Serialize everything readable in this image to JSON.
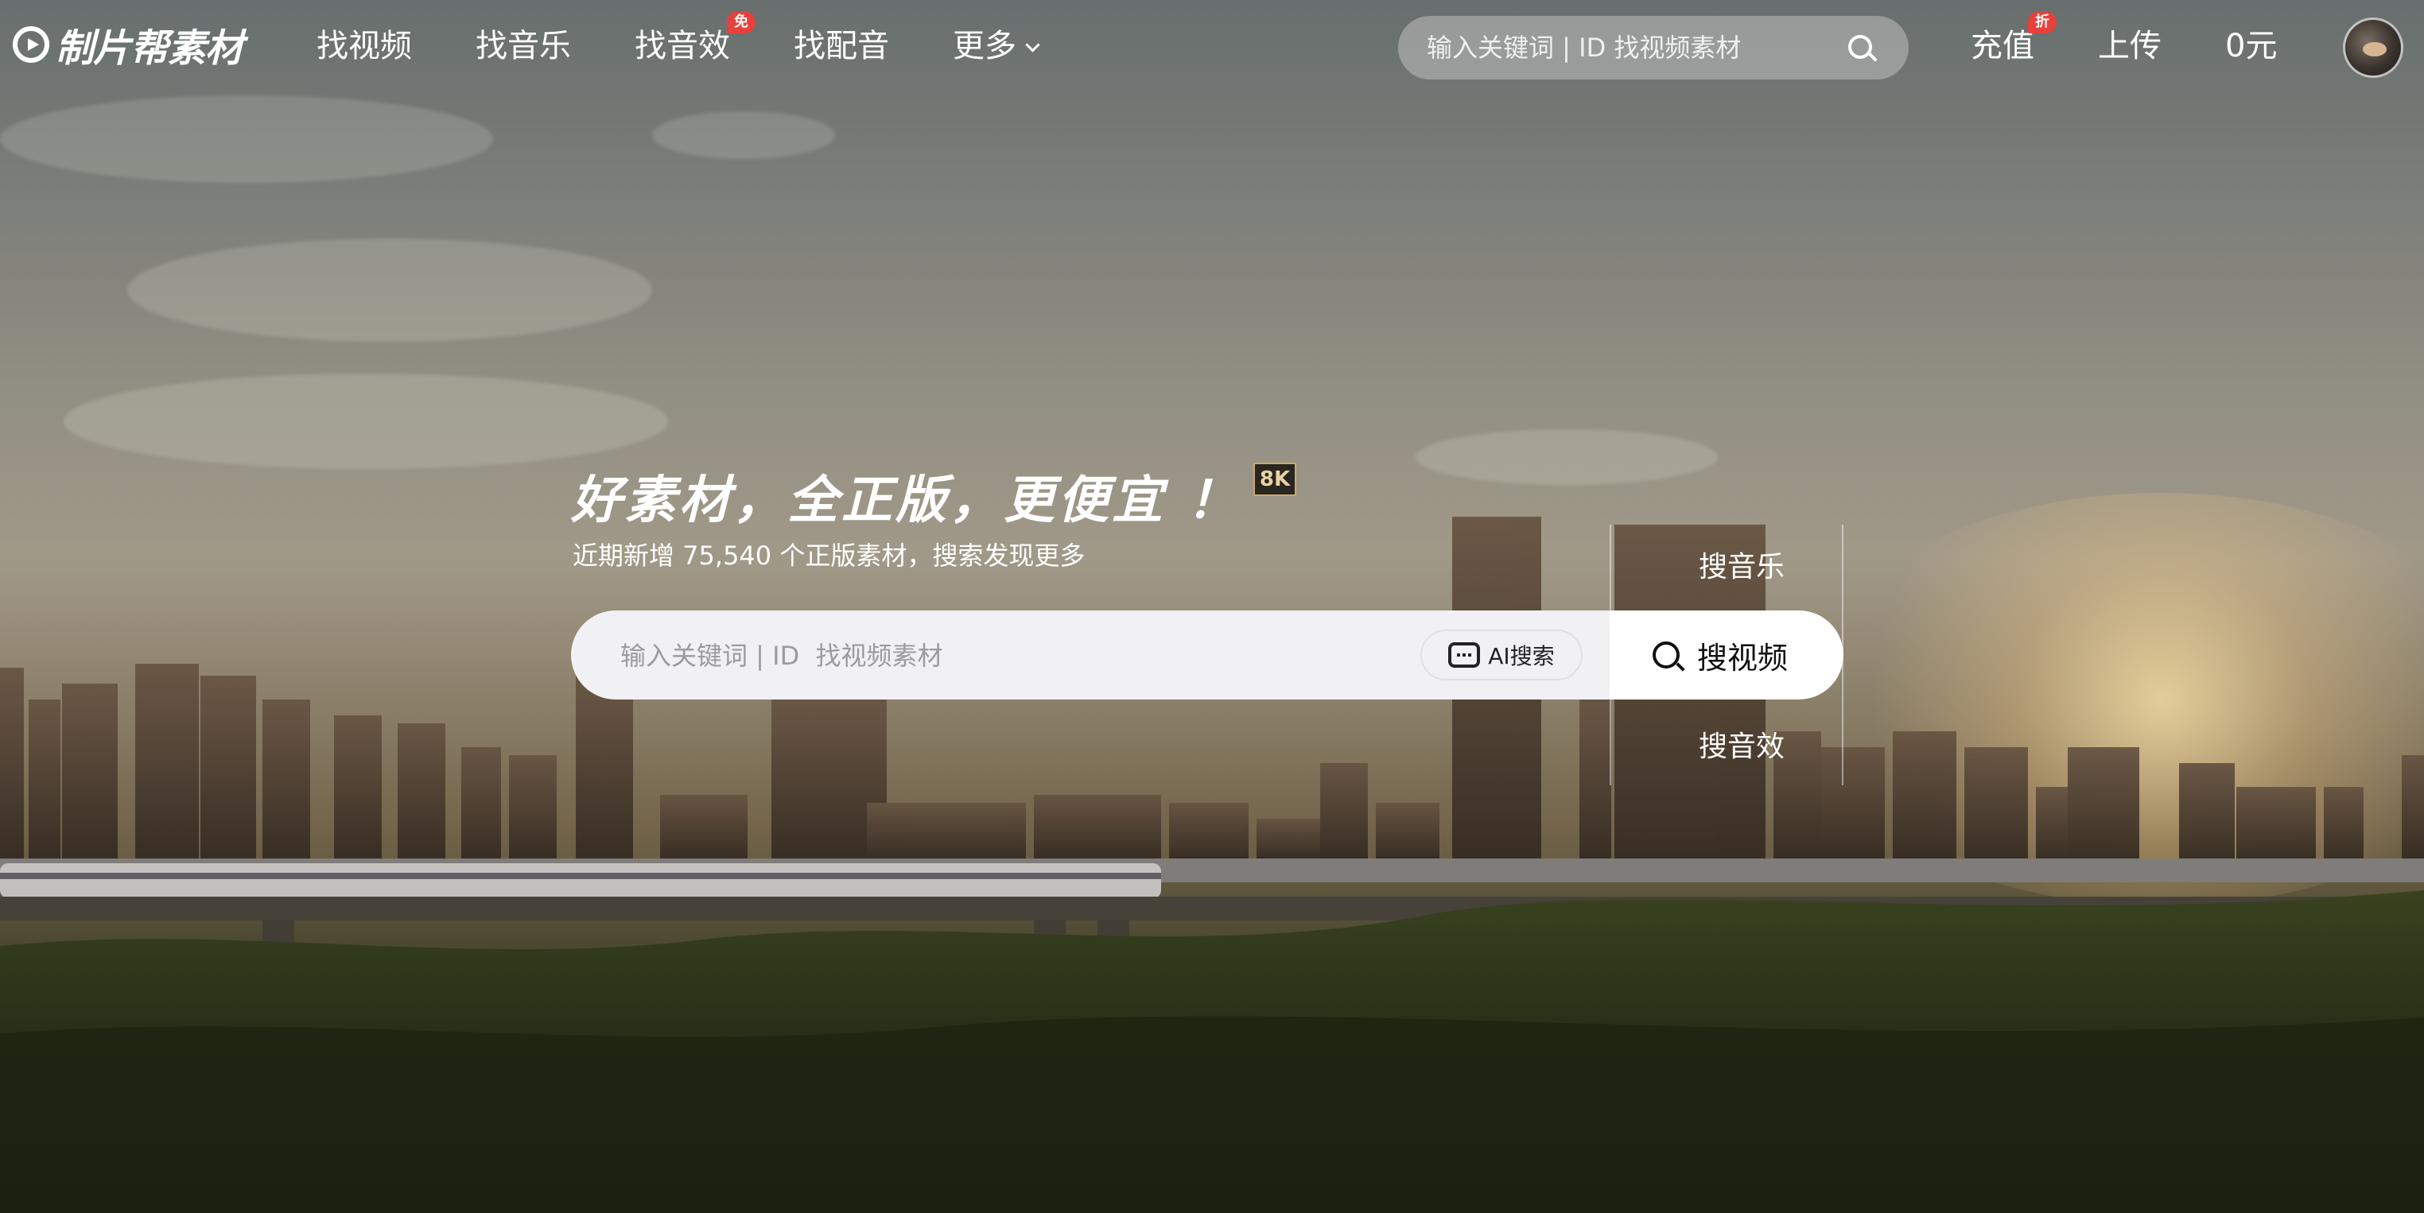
{
  "nav": {
    "logo_text": "制片帮素材",
    "links": [
      {
        "label": "找视频"
      },
      {
        "label": "找音乐"
      },
      {
        "label": "找音效",
        "badge": "免"
      },
      {
        "label": "找配音"
      },
      {
        "label": "更多"
      }
    ],
    "search_placeholder": "输入关键词 | ID 找视频素材",
    "recharge_label": "充值",
    "recharge_badge": "折",
    "upload_label": "上传",
    "balance_label": "0元"
  },
  "hero": {
    "headline": "好素材，全正版，更便宜 ！",
    "resolution_badge": "8K",
    "subline": "近期新增 75,540 个正版素材，搜索发现更多",
    "search_placeholder": "输入关键词 | ID  找视频素材",
    "ai_search_label": "AI搜索",
    "search_types": {
      "above": "搜音乐",
      "active": "搜视频",
      "below": "搜音效"
    }
  },
  "colors": {
    "badge_red": "#e8413b",
    "search_bg": "#f1f1f4"
  }
}
